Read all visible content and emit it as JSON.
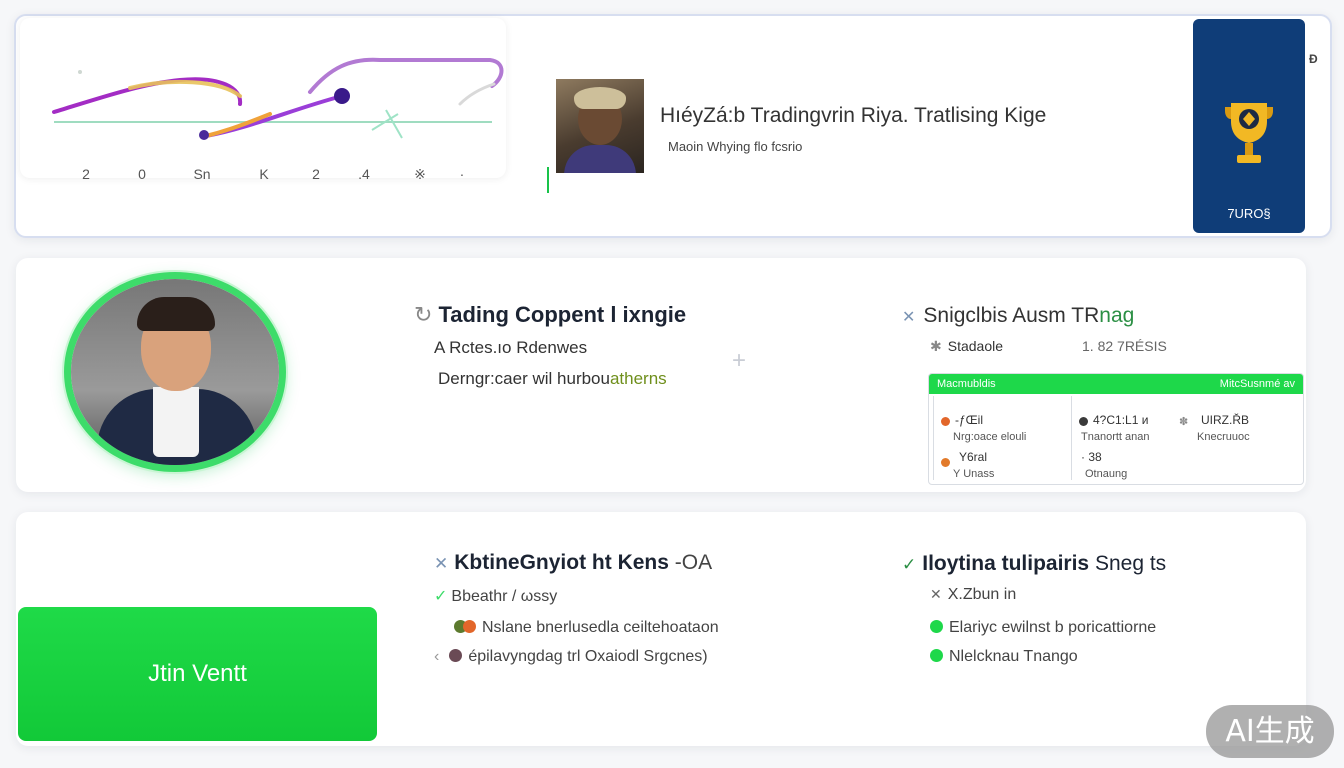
{
  "top": {
    "chart_ticks": [
      "2",
      "0",
      "Sn",
      "K",
      "2",
      ".4",
      "※",
      "·"
    ],
    "title": "HıéyZá:b Tradingvrin Riya. Tratlising Kige",
    "subtitle": "Maoin Whying flo fcsrio",
    "badge_label": "7URO§",
    "corner_icon": "Ɖ"
  },
  "middle": {
    "title": "Tading Coppent l ixngie",
    "line1": "A Rctes.ıo Rdenwes",
    "line2_prefix": "Derngr:caer wil hurbou",
    "line2_highlight": "atherns",
    "right_title_prefix": "Snigclbis Ausm TR",
    "right_title_highlight": "nag",
    "right_sub_a": "Stadaole",
    "right_sub_b": "1. 82 7RÉSIS",
    "table": {
      "head_left": "Macmubldis",
      "head_right": "MitcSusnmé av",
      "col1": [
        {
          "value": "-ƒŒil",
          "label": "Nrg:oace elouli"
        },
        {
          "value": "Y6ral",
          "label": "Y Unass"
        }
      ],
      "col2": [
        {
          "value": "4?C1:L1 и",
          "label": "Tnanortt anan"
        },
        {
          "value": "· 38",
          "label": "Otnaung"
        }
      ],
      "col3": [
        {
          "value": "UIRZ.ŘB",
          "label": "Knecruuoc"
        }
      ]
    }
  },
  "bottom": {
    "join_label": "Jtin Ventt",
    "title_bold": "KbtineGnyiot ht Kens",
    "title_thin": "-OA",
    "sub": "Bbeathr / ωssy",
    "item1": "Nslane bnerlusedla ceiltehoataon",
    "item2": "épilavyngdag trl Oxaiodl Srgcnes)",
    "right_title_bold": "Iloytina tulipairis",
    "right_title_thin": "Sneg ts",
    "right_sub": "X.Zbun in",
    "right_item1": "Elariyc ewilnst b poricattiorne",
    "right_item2": "Nlelcknau Tnango"
  },
  "watermark": "AI生成",
  "colors": {
    "accent_green": "#1ed84a",
    "badge_navy": "#0f3d78",
    "curve_purple": "#a32cc4",
    "curve_orange": "#f0a23a"
  }
}
